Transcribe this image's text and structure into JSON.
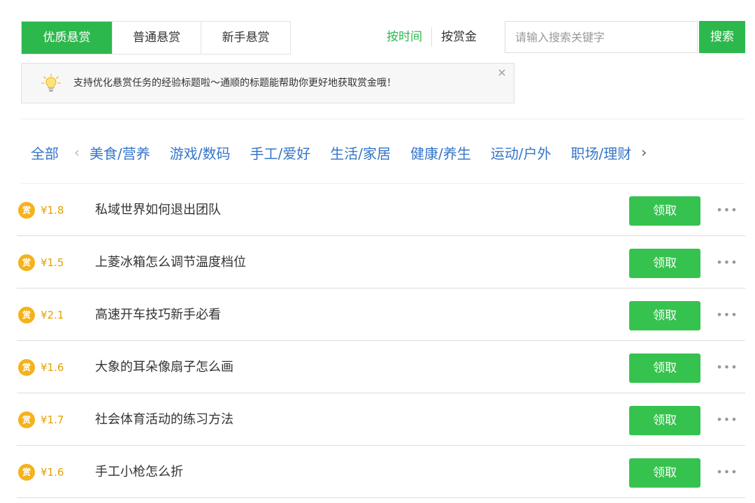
{
  "tabs": [
    {
      "label": "优质悬赏",
      "active": true
    },
    {
      "label": "普通悬赏",
      "active": false
    },
    {
      "label": "新手悬赏",
      "active": false
    }
  ],
  "sort": {
    "by_time": "按时间",
    "by_reward": "按赏金"
  },
  "search": {
    "placeholder": "请输入搜索关键字",
    "button": "搜索"
  },
  "tip": {
    "text": "支持优化悬赏任务的经验标题啦～通顺的标题能帮助你更好地获取赏金哦！",
    "close": "×",
    "icon": "lightbulb-icon"
  },
  "categories": {
    "all": "全部",
    "prev": "‹",
    "next": "›",
    "items": [
      "美食/营养",
      "游戏/数码",
      "手工/爱好",
      "生活/家居",
      "健康/养生",
      "运动/户外",
      "职场/理财"
    ]
  },
  "coin_glyph": "赏",
  "tasks": [
    {
      "reward": "¥1.8",
      "title": "私域世界如何退出团队",
      "action": "领取",
      "more": "•••"
    },
    {
      "reward": "¥1.5",
      "title": "上菱冰箱怎么调节温度档位",
      "action": "领取",
      "more": "•••"
    },
    {
      "reward": "¥2.1",
      "title": "高速开车技巧新手必看",
      "action": "领取",
      "more": "•••"
    },
    {
      "reward": "¥1.6",
      "title": "大象的耳朵像扇子怎么画",
      "action": "领取",
      "more": "•••"
    },
    {
      "reward": "¥1.7",
      "title": "社会体育活动的练习方法",
      "action": "领取",
      "more": "•••"
    },
    {
      "reward": "¥1.6",
      "title": "手工小枪怎么折",
      "action": "领取",
      "more": "•••"
    }
  ],
  "colors": {
    "accent_green": "#2db84d",
    "button_green": "#36c24e",
    "link_blue": "#3575c8",
    "reward_gold": "#e6a100",
    "coin": "#f4b21c"
  }
}
